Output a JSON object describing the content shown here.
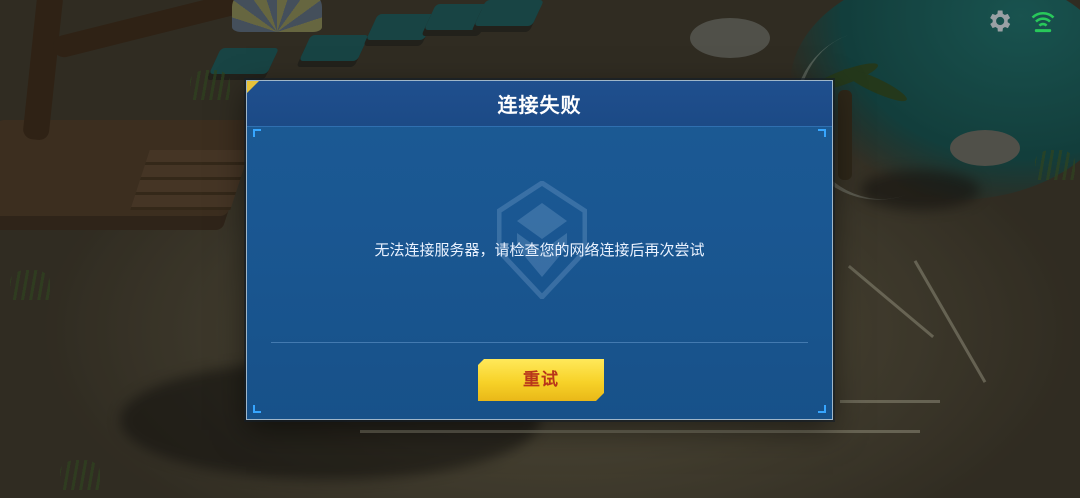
{
  "dialog": {
    "title": "连接失败",
    "message": "无法连接服务器，请检查您的网络连接后再次尝试",
    "retry_label": "重试"
  },
  "hud": {
    "settings_icon": "gear-icon",
    "signal_icon": "wifi-signal-icon"
  },
  "colors": {
    "dialog_bg": "#1a5792",
    "header_bg": "#1f4f8e",
    "button_yellow": "#f7d228",
    "button_text": "#b8361a",
    "signal_green": "#28c85a",
    "corner_flag": "#e6c23a"
  }
}
